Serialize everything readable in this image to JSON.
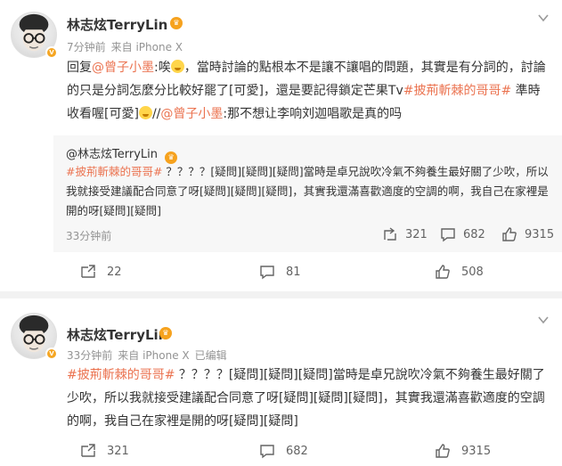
{
  "post1": {
    "author": "林志炫TerryLin",
    "time": "7分钟前",
    "source": "来自 iPhone X",
    "text_parts": {
      "p1": "回复",
      "mention1": "@曾子小墨",
      "p2": ":唉",
      "p3": "，當時討論的點根本不是讓不讓唱的問題，其實是有分詞的，討論的只是分詞怎麼分比較好罷了[可愛]，還是要記得鎖定芒果Tv",
      "topic": "#披荊斬棘的哥哥#",
      "p4": " 準時收看喔[可愛]",
      "p5": "//",
      "mention2": "@曾子小墨",
      "p6": ":那不想让李响刘迦唱歌是真的吗"
    },
    "quoted": {
      "author": "@林志炫TerryLin",
      "topic": "#披荊斬棘的哥哥#",
      "text": " ？？？？[疑問][疑問][疑問]當時是卓兄說吹冷氣不夠養生最好關了少吹，所以我就接受建議配合同意了呀[疑問][疑問][疑問]，其實我還滿喜歡適度的空調的啊，我自己在家裡是開的呀[疑問][疑問]",
      "time": "33分钟前",
      "reposts": "321",
      "comments": "682",
      "likes": "9315"
    },
    "actions": {
      "reposts": "22",
      "comments": "81",
      "likes": "508"
    }
  },
  "post2": {
    "author": "林志炫TerryLin",
    "time": "33分钟前",
    "source": "来自 iPhone X",
    "edited": "已编辑",
    "topic": "#披荊斬棘的哥哥#",
    "text": " ？？？？[疑問][疑問][疑問]當時是卓兄說吹冷氣不夠養生最好關了少吹，所以我就接受建議配合同意了呀[疑問][疑問][疑問]，其實我還滿喜歡適度的空調的啊，我自己在家裡是開的呀[疑問][疑問]",
    "actions": {
      "reposts": "321",
      "comments": "682",
      "likes": "9315"
    }
  },
  "colors": {
    "link": "#eb7350",
    "badge": "#f5a623",
    "quote_bg": "#f7f7f7",
    "meta": "#939393"
  },
  "icons": [
    "avatar",
    "vip-crown-icon",
    "verified-badge-icon",
    "chevron-down-icon",
    "repost-icon",
    "comment-icon",
    "like-icon"
  ]
}
